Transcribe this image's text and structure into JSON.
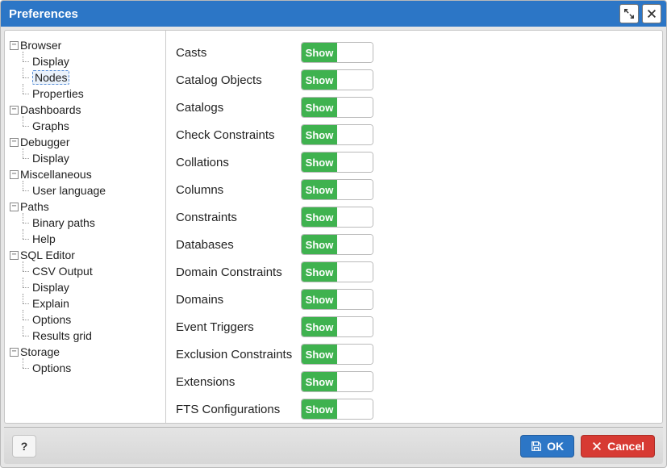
{
  "window": {
    "title": "Preferences"
  },
  "tree": [
    {
      "label": "Browser",
      "expanded": true,
      "children": [
        {
          "label": "Display"
        },
        {
          "label": "Nodes",
          "selected": true
        },
        {
          "label": "Properties"
        }
      ]
    },
    {
      "label": "Dashboards",
      "expanded": true,
      "children": [
        {
          "label": "Graphs"
        }
      ]
    },
    {
      "label": "Debugger",
      "expanded": true,
      "children": [
        {
          "label": "Display"
        }
      ]
    },
    {
      "label": "Miscellaneous",
      "expanded": true,
      "children": [
        {
          "label": "User language"
        }
      ]
    },
    {
      "label": "Paths",
      "expanded": true,
      "children": [
        {
          "label": "Binary paths"
        },
        {
          "label": "Help"
        }
      ]
    },
    {
      "label": "SQL Editor",
      "expanded": true,
      "children": [
        {
          "label": "CSV Output"
        },
        {
          "label": "Display"
        },
        {
          "label": "Explain"
        },
        {
          "label": "Options"
        },
        {
          "label": "Results grid"
        }
      ]
    },
    {
      "label": "Storage",
      "expanded": true,
      "children": [
        {
          "label": "Options"
        }
      ]
    }
  ],
  "toggle_on_label": "Show",
  "settings": [
    {
      "label": "Casts",
      "value": "show"
    },
    {
      "label": "Catalog Objects",
      "value": "show"
    },
    {
      "label": "Catalogs",
      "value": "show"
    },
    {
      "label": "Check Constraints",
      "value": "show"
    },
    {
      "label": "Collations",
      "value": "show"
    },
    {
      "label": "Columns",
      "value": "show"
    },
    {
      "label": "Constraints",
      "value": "show"
    },
    {
      "label": "Databases",
      "value": "show"
    },
    {
      "label": "Domain Constraints",
      "value": "show"
    },
    {
      "label": "Domains",
      "value": "show"
    },
    {
      "label": "Event Triggers",
      "value": "show"
    },
    {
      "label": "Exclusion Constraints",
      "value": "show"
    },
    {
      "label": "Extensions",
      "value": "show"
    },
    {
      "label": "FTS Configurations",
      "value": "show"
    }
  ],
  "footer": {
    "help": "?",
    "ok": "OK",
    "cancel": "Cancel"
  }
}
